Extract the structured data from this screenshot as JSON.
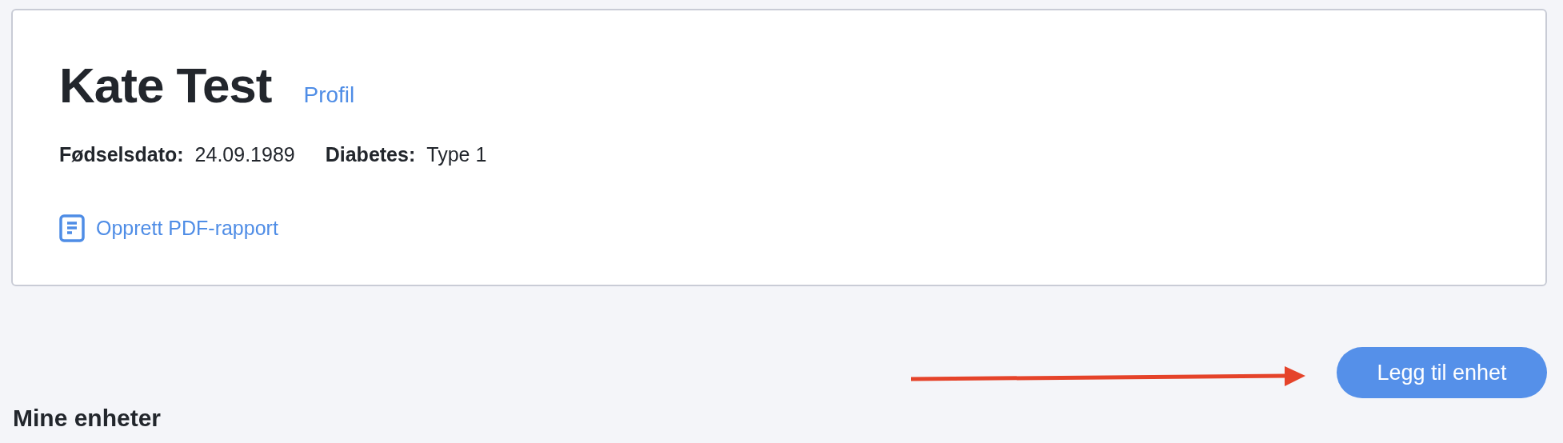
{
  "patient": {
    "name": "Kate Test",
    "profile_link": "Profil",
    "details": [
      {
        "label": "Fødselsdato:",
        "value": "24.09.1989"
      },
      {
        "label": "Diabetes:",
        "value": "Type 1"
      }
    ],
    "pdf_link": "Opprett PDF-rapport"
  },
  "add_device_button": "Legg til enhet",
  "devices_section": {
    "title": "Mine enheter"
  }
}
